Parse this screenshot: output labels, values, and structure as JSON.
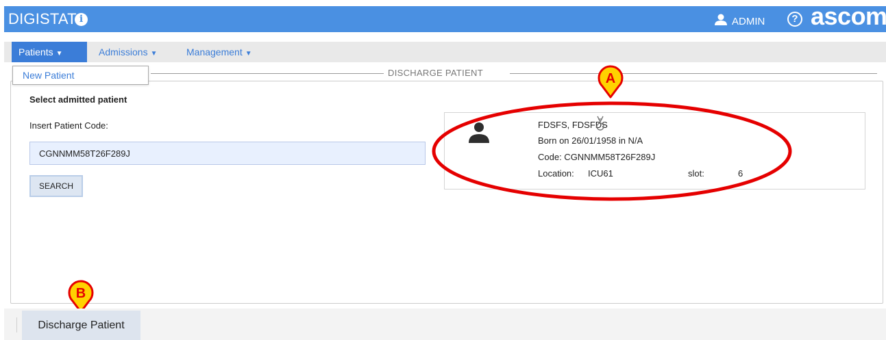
{
  "app": {
    "title": "DIGISTAT",
    "user": "ADMIN",
    "brand": "ascom"
  },
  "menu": {
    "items": [
      {
        "label": "Patients"
      },
      {
        "label": "Admissions"
      },
      {
        "label": "Management"
      }
    ],
    "dropdown": {
      "items": [
        {
          "label": "New Patient"
        }
      ]
    }
  },
  "section": {
    "title": "DISCHARGE PATIENT"
  },
  "form": {
    "select_label": "Select admitted patient",
    "code_label": "Insert Patient Code:",
    "code_value": "CGNNMM58T26F289J",
    "search_label": "SEARCH"
  },
  "patient": {
    "name": "FDSFS, FDSFDS",
    "born": "Born on 26/01/1958 in N/A",
    "code": "Code: CGNNMM58T26F289J",
    "location_label": "Location:",
    "location_value": "ICU61",
    "slot_label": "slot:",
    "slot_value": "6"
  },
  "annotations": {
    "marker_a": "A",
    "marker_b": "B"
  },
  "footer": {
    "discharge_label": "Discharge Patient"
  },
  "colors": {
    "header_bg": "#4a90e2",
    "menu_accent": "#3b7dd8",
    "highlight": "#e50000",
    "marker_fill": "#ffd200"
  }
}
